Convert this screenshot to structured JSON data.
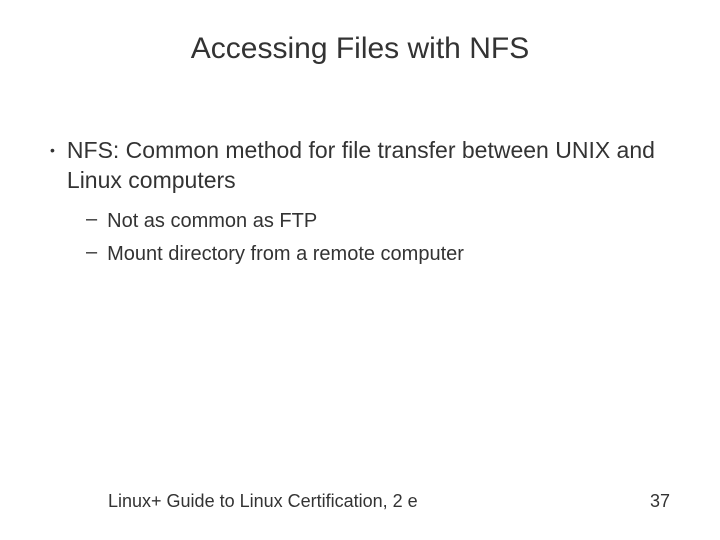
{
  "slide": {
    "title": "Accessing Files with NFS",
    "bullets": [
      {
        "text": "NFS: Common method for file transfer between UNIX and Linux computers",
        "sub": [
          "Not as common as FTP",
          "Mount directory from a remote computer"
        ]
      }
    ],
    "footer": {
      "left": "Linux+ Guide to Linux Certification, 2 e",
      "page": "37"
    }
  }
}
